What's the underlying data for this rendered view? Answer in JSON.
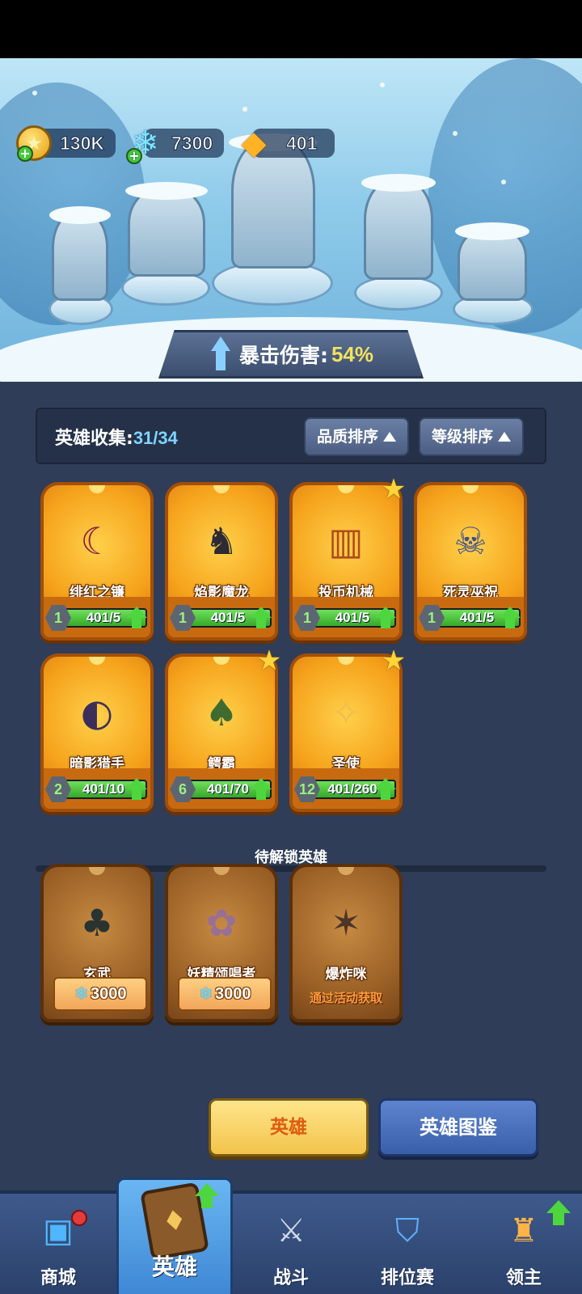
{
  "currency": {
    "gold": "130K",
    "gems": "7300",
    "crystals": "401"
  },
  "scene": {
    "crit_label": "暴击伤害:",
    "crit_value": "54%"
  },
  "collection": {
    "label": "英雄收集:",
    "count": "31/34",
    "sort_quality": "品质排序",
    "sort_level": "等级排序"
  },
  "heroes": [
    {
      "name": "绯红之镰",
      "level": "1",
      "progress": "401/5",
      "fill": 1.0,
      "star": false,
      "icon": "scythe-demon-icon"
    },
    {
      "name": "焰影魔龙",
      "level": "1",
      "progress": "401/5",
      "fill": 1.0,
      "star": false,
      "icon": "dragon-icon"
    },
    {
      "name": "投币机械",
      "level": "1",
      "progress": "401/5",
      "fill": 1.0,
      "star": true,
      "icon": "slot-machine-icon"
    },
    {
      "name": "死灵巫祝",
      "level": "1",
      "progress": "401/5",
      "fill": 1.0,
      "star": false,
      "icon": "necromancer-icon"
    },
    {
      "name": "暗影猎手",
      "level": "2",
      "progress": "401/10",
      "fill": 1.0,
      "star": false,
      "icon": "hooded-hunter-icon"
    },
    {
      "name": "鳄霸",
      "level": "6",
      "progress": "401/70",
      "fill": 1.0,
      "star": true,
      "icon": "crocodile-icon"
    },
    {
      "name": "圣使",
      "level": "12",
      "progress": "401/260",
      "fill": 1.0,
      "star": true,
      "icon": "angel-icon"
    }
  ],
  "locked": {
    "title": "待解锁英雄",
    "heroes": [
      {
        "name": "玄武",
        "cost": "3000",
        "icon": "turtle-beast-icon"
      },
      {
        "name": "妖精颂唱者",
        "cost": "3000",
        "icon": "fairy-icon"
      },
      {
        "name": "爆炸咪",
        "event_text": "通过活动获取",
        "icon": "cat-bomber-icon"
      }
    ]
  },
  "buttons": {
    "hero": "英雄",
    "atlas": "英雄图鉴"
  },
  "tabs": [
    {
      "label": "商城",
      "icon": "shop-icon"
    },
    {
      "label": "英雄",
      "icon": "hero-card-icon"
    },
    {
      "label": "战斗",
      "icon": "crossed-swords-icon"
    },
    {
      "label": "排位赛",
      "icon": "rank-shield-icon"
    },
    {
      "label": "领主",
      "icon": "castle-icon"
    }
  ]
}
